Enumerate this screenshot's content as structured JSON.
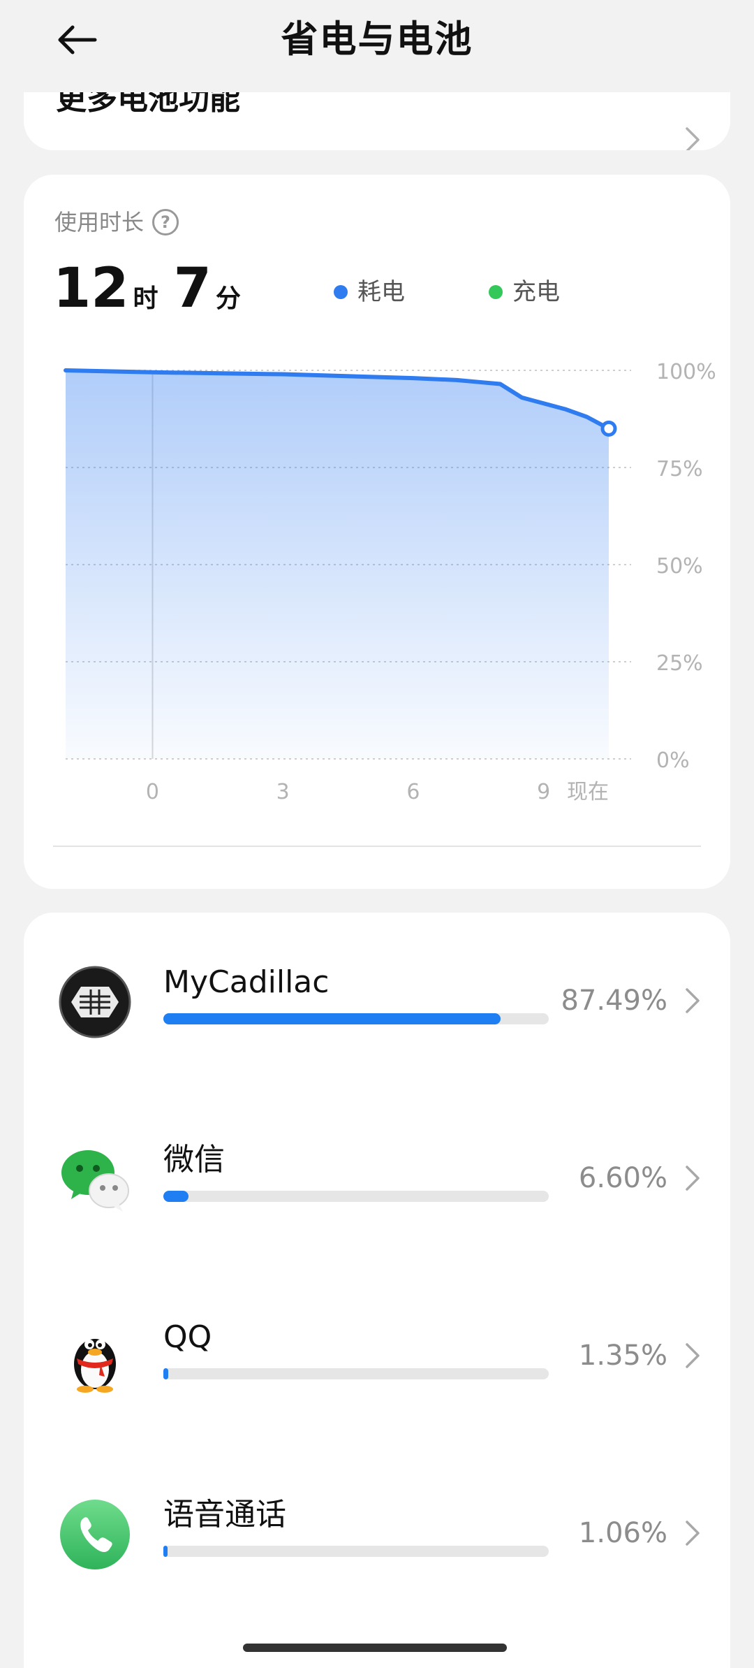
{
  "header": {
    "title": "省电与电池",
    "back_icon": "arrow-left-icon"
  },
  "more_card": {
    "label": "更多电池功能",
    "icon": "chevron-right-icon"
  },
  "usage": {
    "title": "使用时长",
    "help_icon": "question-circle-icon",
    "hours": "12",
    "hours_unit": "时",
    "minutes": "7",
    "minutes_unit": "分",
    "legend": [
      {
        "label": "耗电",
        "color": "#2f7bf0"
      },
      {
        "label": "充电",
        "color": "#34c759"
      }
    ]
  },
  "chart_data": {
    "type": "area",
    "y_tick_labels": [
      "100%",
      "75%",
      "50%",
      "25%",
      "0%"
    ],
    "x_tick_labels": [
      "0",
      "3",
      "6",
      "9",
      "现在"
    ],
    "ylim": [
      0,
      100
    ],
    "x_range": [
      -2,
      10.5
    ],
    "grid": true,
    "series": [
      {
        "color": "#2f7bf0",
        "x": [
          -2,
          0,
          3,
          6,
          7,
          7.5,
          8,
          8.5,
          9,
          9.5,
          10,
          10.5
        ],
        "y": [
          100,
          99.5,
          99,
          98,
          97.5,
          97,
          96.5,
          93,
          91.5,
          90,
          88,
          85
        ]
      }
    ]
  },
  "apps": [
    {
      "name": "MyCadillac",
      "percent_text": "87.49%",
      "percent": 87.49,
      "icon": "cadillac-app-icon"
    },
    {
      "name": "微信",
      "percent_text": "6.60%",
      "percent": 6.6,
      "icon": "wechat-app-icon"
    },
    {
      "name": "QQ",
      "percent_text": "1.35%",
      "percent": 1.35,
      "icon": "qq-app-icon"
    },
    {
      "name": "语音通话",
      "percent_text": "1.06%",
      "percent": 1.06,
      "icon": "phone-call-app-icon"
    }
  ]
}
